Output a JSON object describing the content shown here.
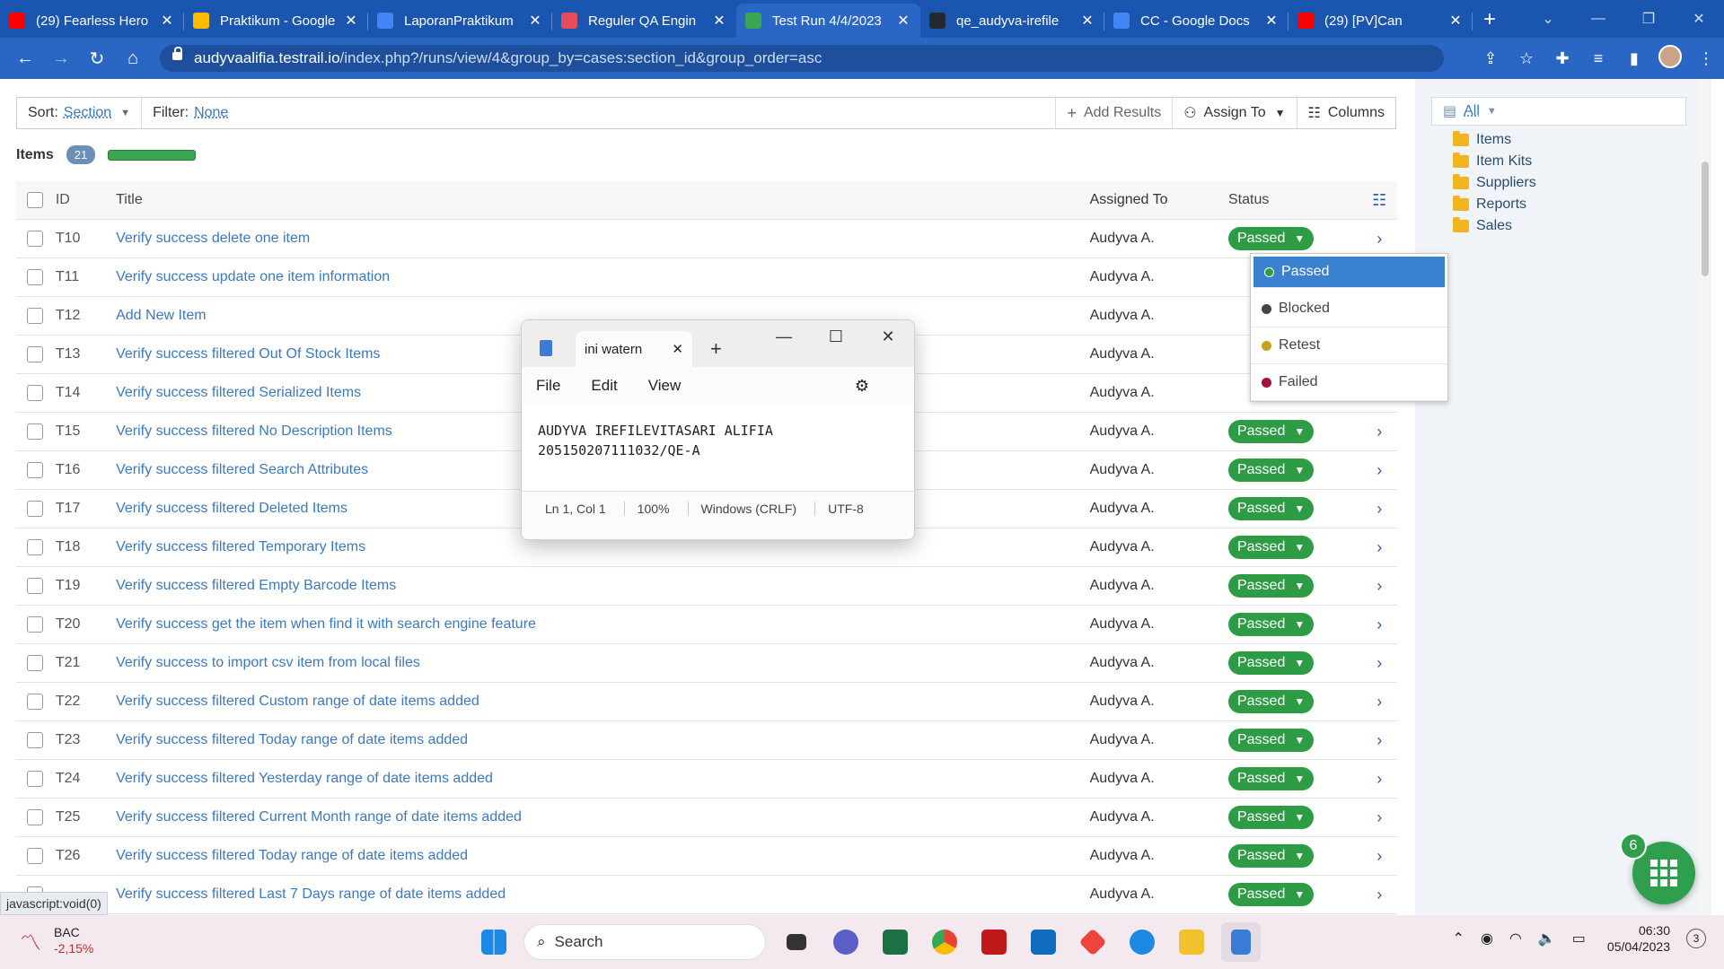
{
  "tabs": [
    {
      "title": "(29) Fearless Hero",
      "color": "#ff0000"
    },
    {
      "title": "Praktikum - Google",
      "color": "#fbbc04"
    },
    {
      "title": "LaporanPraktikum",
      "color": "#4285f4"
    },
    {
      "title": "Reguler QA Engin",
      "color": "#e64b5a"
    },
    {
      "title": "Test Run 4/4/2023",
      "color": "#3aa652"
    },
    {
      "title": "qe_audyva-irefile",
      "color": "#24292f"
    },
    {
      "title": "CC - Google Docs",
      "color": "#4285f4"
    },
    {
      "title": "(29) [PV]Can",
      "color": "#ff0000"
    }
  ],
  "address": {
    "domain": "audyvaalifia.testrail.io",
    "path": "/index.php?/runs/view/4&group_by=cases:section_id&group_order=asc"
  },
  "toolbar": {
    "sort_label": "Sort:",
    "sort_value": "Section",
    "filter_label": "Filter:",
    "filter_value": "None",
    "add_results": "Add Results",
    "assign_to": "Assign To",
    "columns": "Columns"
  },
  "items_header": {
    "label": "Items",
    "count": "21",
    "progress": 1.0
  },
  "tree": {
    "selector": "All",
    "folders": [
      "Items",
      "Item Kits",
      "Suppliers",
      "Reports",
      "Sales"
    ]
  },
  "grid": {
    "headers": {
      "id": "ID",
      "title": "Title",
      "assigned": "Assigned To",
      "status": "Status"
    },
    "rows": [
      {
        "id": "T10",
        "title": "Verify success delete one item",
        "assigned": "Audyva A.",
        "status": "Passed"
      },
      {
        "id": "T11",
        "title": "Verify success update one item information",
        "assigned": "Audyva A.",
        "status": ""
      },
      {
        "id": "T12",
        "title": "Add New Item",
        "assigned": "Audyva A.",
        "status": ""
      },
      {
        "id": "T13",
        "title": "Verify success filtered Out Of Stock Items",
        "assigned": "Audyva A.",
        "status": ""
      },
      {
        "id": "T14",
        "title": "Verify success filtered Serialized Items",
        "assigned": "Audyva A.",
        "status": ""
      },
      {
        "id": "T15",
        "title": "Verify success filtered No Description Items",
        "assigned": "Audyva A.",
        "status": "Passed"
      },
      {
        "id": "T16",
        "title": "Verify success filtered Search Attributes",
        "assigned": "Audyva A.",
        "status": "Passed"
      },
      {
        "id": "T17",
        "title": "Verify success filtered Deleted Items",
        "assigned": "Audyva A.",
        "status": "Passed"
      },
      {
        "id": "T18",
        "title": "Verify success filtered Temporary Items",
        "assigned": "Audyva A.",
        "status": "Passed"
      },
      {
        "id": "T19",
        "title": "Verify success filtered Empty Barcode Items",
        "assigned": "Audyva A.",
        "status": "Passed"
      },
      {
        "id": "T20",
        "title": "Verify success get the item when find it with search engine feature",
        "assigned": "Audyva A.",
        "status": "Passed"
      },
      {
        "id": "T21",
        "title": "Verify success to import csv item from local files",
        "assigned": "Audyva A.",
        "status": "Passed"
      },
      {
        "id": "T22",
        "title": "Verify success filtered Custom range of date items added",
        "assigned": "Audyva A.",
        "status": "Passed"
      },
      {
        "id": "T23",
        "title": "Verify success filtered Today range of date items added",
        "assigned": "Audyva A.",
        "status": "Passed"
      },
      {
        "id": "T24",
        "title": "Verify success filtered Yesterday range of date items added",
        "assigned": "Audyva A.",
        "status": "Passed"
      },
      {
        "id": "T25",
        "title": "Verify success filtered Current Month range of date items added",
        "assigned": "Audyva A.",
        "status": "Passed"
      },
      {
        "id": "T26",
        "title": "Verify success filtered Today range of date items added",
        "assigned": "Audyva A.",
        "status": "Passed"
      },
      {
        "id": "",
        "title": "Verify success filtered Last 7 Days range of date items added",
        "assigned": "Audyva A.",
        "status": "Passed"
      }
    ]
  },
  "status_menu": [
    {
      "label": "Passed",
      "color": "#2e9b45"
    },
    {
      "label": "Blocked",
      "color": "#444444"
    },
    {
      "label": "Retest",
      "color": "#c9a21a"
    },
    {
      "label": "Failed",
      "color": "#a3123c"
    }
  ],
  "notepad": {
    "tab_title": "ini watern",
    "menu": [
      "File",
      "Edit",
      "View"
    ],
    "line1": "AUDYVA IREFILEVITASARI ALIFIA",
    "line2": "205150207111032/QE-A",
    "status": [
      "Ln 1, Col 1",
      "100%",
      "Windows (CRLF)",
      "UTF-8"
    ]
  },
  "fab": {
    "count": "6"
  },
  "statusbar": "javascript:void(0)",
  "taskbar": {
    "ticker": "BAC",
    "change": "-2,15%",
    "search": "Search",
    "time": "06:30",
    "date": "05/04/2023",
    "notifications": "3"
  }
}
